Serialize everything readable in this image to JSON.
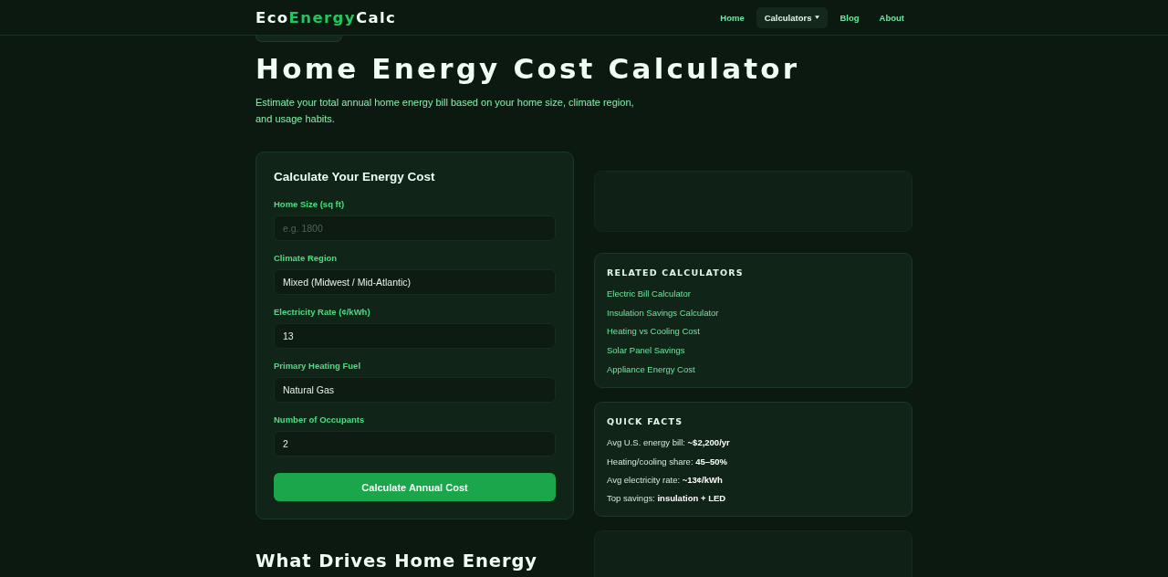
{
  "header": {
    "logo": [
      {
        "text": "Eco",
        "accent": false
      },
      {
        "text": "Energy",
        "accent": true
      },
      {
        "text": "Calc",
        "accent": false
      }
    ],
    "nav": [
      {
        "label": "Home",
        "selected": false,
        "dropdown": false
      },
      {
        "label": "Calculators",
        "selected": true,
        "dropdown": true
      },
      {
        "label": "Blog",
        "selected": false,
        "dropdown": false
      },
      {
        "label": "About",
        "selected": false,
        "dropdown": false
      }
    ]
  },
  "hero": {
    "title": "Home Energy Cost Calculator",
    "description": "Estimate your total annual home energy bill based on your home size, climate region, and usage habits."
  },
  "calculator": {
    "title": "Calculate Your Energy Cost",
    "fields": [
      {
        "label": "Home Size (sq ft)",
        "placeholder": "e.g. 1800"
      },
      {
        "label": "Climate Region",
        "value": "Mixed (Midwest / Mid-Atlantic)"
      },
      {
        "label": "Electricity Rate (¢/kWh)",
        "value": "13"
      },
      {
        "label": "Primary Heating Fuel",
        "value": "Natural Gas"
      },
      {
        "label": "Number of Occupants",
        "value": "2"
      }
    ],
    "button": "Calculate Annual Cost"
  },
  "section_heading": "What Drives Home Energy",
  "sidebar": [
    {
      "kind": "blank"
    },
    {
      "kind": "links",
      "title": "RELATED CALCULATORS",
      "items": [
        "Electric Bill Calculator",
        "Insulation Savings Calculator",
        "Heating vs Cooling Cost",
        "Solar Panel Savings",
        "Appliance Energy Cost"
      ]
    },
    {
      "kind": "facts",
      "title": "QUICK FACTS",
      "items": [
        "Avg U.S. energy bill: **~$2,200/yr**",
        "Heating/cooling share: **45–50%**",
        "Avg electricity rate: **~13¢/kWh**",
        "Top savings: **insulation + LED**"
      ]
    },
    {
      "kind": "blank"
    }
  ]
}
